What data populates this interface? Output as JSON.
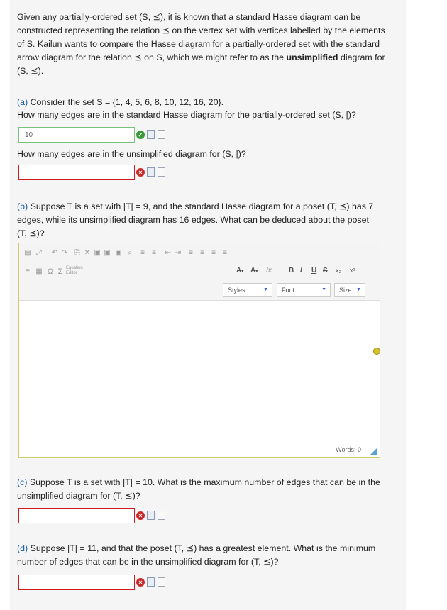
{
  "intro": {
    "l1": "Given any partially-ordered set (S, ⪯), it is known that a standard Hasse diagram can be",
    "l2": "constructed representing the relation ⪯ on the vertex set with vertices labelled by the elements",
    "l3": "of S. Kailun wants to compare the Hasse diagram for a partially-ordered set with the standard",
    "l4a": "arrow diagram for the relation ⪯ on S, which we might refer to as the ",
    "l4b": "unsimplified",
    "l4c": " diagram for",
    "l5": "(S, ⪯)."
  },
  "a": {
    "label": "(a)",
    "line1": "Consider the set S = {1, 4, 5, 6, 8, 10, 12, 16, 20}.",
    "q1": "How many edges are in the standard Hasse diagram for the partially-ordered set (S, |)?",
    "answer1": "10",
    "q2": "How many edges are in the unsimplified diagram for (S, |)?",
    "answer2": ""
  },
  "b": {
    "label": "(b)",
    "l1": "Suppose T is a set with |T| = 9, and the standard Hasse diagram for a poset (T, ⪯) has 7",
    "l2": "edges, while its unsimplified diagram has 16 edges. What can be deduced about the poset",
    "l3": "(T, ⪯)?"
  },
  "editor": {
    "equation_label1": "Equation",
    "equation_label2": "Editor",
    "font_color": "A",
    "bg_color": "A",
    "clear_format": "Ix",
    "bold": "B",
    "italic": "I",
    "underline": "U",
    "strike": "S",
    "subscript": "x₂",
    "superscript": "x²",
    "styles": "Styles",
    "font": "Font",
    "size": "Size",
    "words": "Words: 0"
  },
  "c": {
    "label": "(c)",
    "l1": "Suppose T is a set with |T| = 10. What is the maximum number of edges that can be in the",
    "l2": "unsimplified diagram for (T, ⪯)?"
  },
  "d": {
    "label": "(d)",
    "l1": "Suppose |T| = 11, and that the poset (T, ⪯) has a greatest element. What is the minimum",
    "l2": "number of edges that can be in the unsimplified diagram for (T, ⪯)?"
  }
}
